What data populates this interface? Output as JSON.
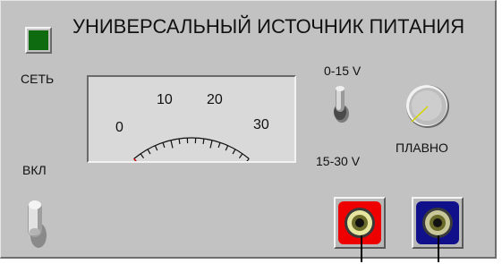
{
  "title": "УНИВЕРСАЛЬНЫЙ ИСТОЧНИК ПИТАНИЯ",
  "labels": {
    "power_indicator": "СЕТЬ",
    "power_switch": "ВКЛ",
    "range_upper": "0-15 V",
    "range_lower": "15-30 V",
    "knob": "ПЛАВНО"
  },
  "meter": {
    "scale_labels": [
      "0",
      "10",
      "20",
      "30"
    ],
    "needle_value": 0
  },
  "colors": {
    "panel": "#c2c2c2",
    "indicator_led": "#0f6b0f",
    "terminal_positive": "#ee0000",
    "terminal_negative": "#10108a"
  },
  "icons": {
    "knob": "rotary-knob-icon",
    "range_toggle": "toggle-switch-icon",
    "power_toggle": "toggle-switch-icon",
    "positive_terminal": "banana-jack-red-icon",
    "negative_terminal": "banana-jack-blue-icon"
  }
}
